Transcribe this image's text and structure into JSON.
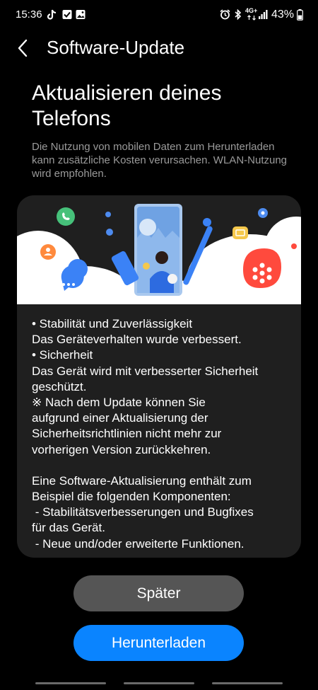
{
  "status_bar": {
    "time": "15:36",
    "battery": "43%",
    "network": "4G+",
    "left_icons": [
      "tiktok-icon",
      "checkbox-icon",
      "gallery-icon"
    ],
    "right_icons": [
      "alarm-icon",
      "bluetooth-icon",
      "network-4g-icon",
      "signal-icon",
      "battery-icon"
    ]
  },
  "app_bar": {
    "title": "Software-Update"
  },
  "headline": {
    "line1": "Aktualisieren deines",
    "line2": "Telefons"
  },
  "subtext": "Die Nutzung von mobilen Daten zum Herunterladen kann zusätzliche Kosten verursachen. WLAN-Nutzung wird empfohlen.",
  "card": {
    "lines": [
      "• Stabilität und Zuverlässigkeit",
      "Das Geräteverhalten wurde verbessert.",
      "• Sicherheit",
      "Das Gerät wird mit verbesserter Sicherheit",
      "geschützt.",
      "※ Nach dem Update können Sie",
      "aufgrund einer Aktualisierung der",
      "Sicherheitsrichtlinien nicht mehr zur",
      "vorherigen Version zurückkehren.",
      "",
      "Eine Software-Aktualisierung enthält zum",
      "Beispiel die folgenden Komponenten:",
      " - Stabilitätsverbesserungen und Bugfixes",
      "für das Gerät.",
      " - Neue und/oder erweiterte Funktionen."
    ]
  },
  "buttons": {
    "later": "Später",
    "download": "Herunterladen"
  },
  "colors": {
    "accent": "#0a84ff",
    "background": "#000000",
    "card": "#1f1f1f",
    "secondary_button": "#555555"
  }
}
